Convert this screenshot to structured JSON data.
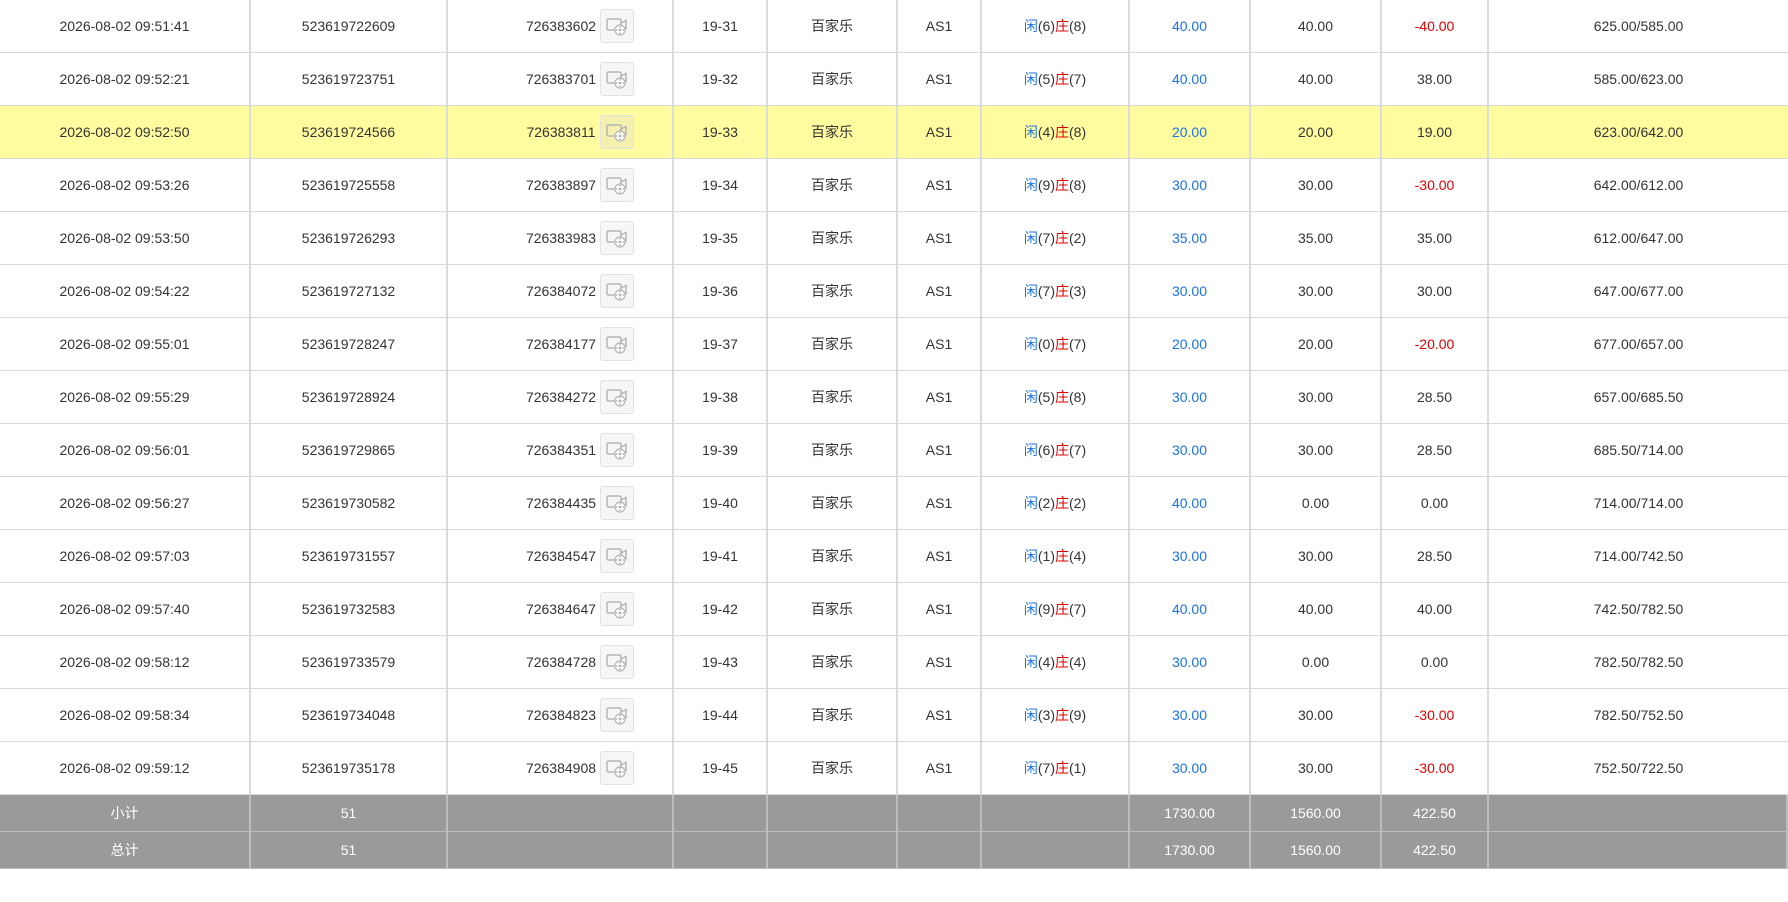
{
  "rows": [
    {
      "time": "2026-08-02 09:51:41",
      "id": "523619722609",
      "round": "726383602",
      "shoe": "19-31",
      "game": "百家乐",
      "table": "AS1",
      "xian_label": "闲",
      "xian": "(6)",
      "zhuang_label": "庄",
      "zhuang": "(8)",
      "bet": "40.00",
      "valid": "40.00",
      "winlose": "-40.00",
      "balance": "625.00/585.00"
    },
    {
      "time": "2026-08-02 09:52:21",
      "id": "523619723751",
      "round": "726383701",
      "shoe": "19-32",
      "game": "百家乐",
      "table": "AS1",
      "xian_label": "闲",
      "xian": "(5)",
      "zhuang_label": "庄",
      "zhuang": "(7)",
      "bet": "40.00",
      "valid": "40.00",
      "winlose": "38.00",
      "balance": "585.00/623.00"
    },
    {
      "time": "2026-08-02 09:52:50",
      "id": "523619724566",
      "round": "726383811",
      "shoe": "19-33",
      "game": "百家乐",
      "table": "AS1",
      "xian_label": "闲",
      "xian": "(4)",
      "zhuang_label": "庄",
      "zhuang": "(8)",
      "bet": "20.00",
      "valid": "20.00",
      "winlose": "19.00",
      "balance": "623.00/642.00"
    },
    {
      "time": "2026-08-02 09:53:26",
      "id": "523619725558",
      "round": "726383897",
      "shoe": "19-34",
      "game": "百家乐",
      "table": "AS1",
      "xian_label": "闲",
      "xian": "(9)",
      "zhuang_label": "庄",
      "zhuang": "(8)",
      "bet": "30.00",
      "valid": "30.00",
      "winlose": "-30.00",
      "balance": "642.00/612.00"
    },
    {
      "time": "2026-08-02 09:53:50",
      "id": "523619726293",
      "round": "726383983",
      "shoe": "19-35",
      "game": "百家乐",
      "table": "AS1",
      "xian_label": "闲",
      "xian": "(7)",
      "zhuang_label": "庄",
      "zhuang": "(2)",
      "bet": "35.00",
      "valid": "35.00",
      "winlose": "35.00",
      "balance": "612.00/647.00"
    },
    {
      "time": "2026-08-02 09:54:22",
      "id": "523619727132",
      "round": "726384072",
      "shoe": "19-36",
      "game": "百家乐",
      "table": "AS1",
      "xian_label": "闲",
      "xian": "(7)",
      "zhuang_label": "庄",
      "zhuang": "(3)",
      "bet": "30.00",
      "valid": "30.00",
      "winlose": "30.00",
      "balance": "647.00/677.00"
    },
    {
      "time": "2026-08-02 09:55:01",
      "id": "523619728247",
      "round": "726384177",
      "shoe": "19-37",
      "game": "百家乐",
      "table": "AS1",
      "xian_label": "闲",
      "xian": "(0)",
      "zhuang_label": "庄",
      "zhuang": "(7)",
      "bet": "20.00",
      "valid": "20.00",
      "winlose": "-20.00",
      "balance": "677.00/657.00"
    },
    {
      "time": "2026-08-02 09:55:29",
      "id": "523619728924",
      "round": "726384272",
      "shoe": "19-38",
      "game": "百家乐",
      "table": "AS1",
      "xian_label": "闲",
      "xian": "(5)",
      "zhuang_label": "庄",
      "zhuang": "(8)",
      "bet": "30.00",
      "valid": "30.00",
      "winlose": "28.50",
      "balance": "657.00/685.50"
    },
    {
      "time": "2026-08-02 09:56:01",
      "id": "523619729865",
      "round": "726384351",
      "shoe": "19-39",
      "game": "百家乐",
      "table": "AS1",
      "xian_label": "闲",
      "xian": "(6)",
      "zhuang_label": "庄",
      "zhuang": "(7)",
      "bet": "30.00",
      "valid": "30.00",
      "winlose": "28.50",
      "balance": "685.50/714.00"
    },
    {
      "time": "2026-08-02 09:56:27",
      "id": "523619730582",
      "round": "726384435",
      "shoe": "19-40",
      "game": "百家乐",
      "table": "AS1",
      "xian_label": "闲",
      "xian": "(2)",
      "zhuang_label": "庄",
      "zhuang": "(2)",
      "bet": "40.00",
      "valid": "0.00",
      "winlose": "0.00",
      "balance": "714.00/714.00"
    },
    {
      "time": "2026-08-02 09:57:03",
      "id": "523619731557",
      "round": "726384547",
      "shoe": "19-41",
      "game": "百家乐",
      "table": "AS1",
      "xian_label": "闲",
      "xian": "(1)",
      "zhuang_label": "庄",
      "zhuang": "(4)",
      "bet": "30.00",
      "valid": "30.00",
      "winlose": "28.50",
      "balance": "714.00/742.50"
    },
    {
      "time": "2026-08-02 09:57:40",
      "id": "523619732583",
      "round": "726384647",
      "shoe": "19-42",
      "game": "百家乐",
      "table": "AS1",
      "xian_label": "闲",
      "xian": "(9)",
      "zhuang_label": "庄",
      "zhuang": "(7)",
      "bet": "40.00",
      "valid": "40.00",
      "winlose": "40.00",
      "balance": "742.50/782.50"
    },
    {
      "time": "2026-08-02 09:58:12",
      "id": "523619733579",
      "round": "726384728",
      "shoe": "19-43",
      "game": "百家乐",
      "table": "AS1",
      "xian_label": "闲",
      "xian": "(4)",
      "zhuang_label": "庄",
      "zhuang": "(4)",
      "bet": "30.00",
      "valid": "0.00",
      "winlose": "0.00",
      "balance": "782.50/782.50"
    },
    {
      "time": "2026-08-02 09:58:34",
      "id": "523619734048",
      "round": "726384823",
      "shoe": "19-44",
      "game": "百家乐",
      "table": "AS1",
      "xian_label": "闲",
      "xian": "(3)",
      "zhuang_label": "庄",
      "zhuang": "(9)",
      "bet": "30.00",
      "valid": "30.00",
      "winlose": "-30.00",
      "balance": "782.50/752.50"
    },
    {
      "time": "2026-08-02 09:59:12",
      "id": "523619735178",
      "round": "726384908",
      "shoe": "19-45",
      "game": "百家乐",
      "table": "AS1",
      "xian_label": "闲",
      "xian": "(7)",
      "zhuang_label": "庄",
      "zhuang": "(1)",
      "bet": "30.00",
      "valid": "30.00",
      "winlose": "-30.00",
      "balance": "752.50/722.50"
    }
  ],
  "highlight_row": 2,
  "icons": {
    "video": "video-replay-icon"
  },
  "colors": {
    "highlight": "#fffca0",
    "footer": "#9a9a9a",
    "positive_blue": "#1a73e8",
    "negative_red": "#e00000"
  },
  "subtotal": {
    "label": "小计",
    "count": "51",
    "bet": "1730.00",
    "valid": "1560.00",
    "winlose": "422.50"
  },
  "total": {
    "label": "总计",
    "count": "51",
    "bet": "1730.00",
    "valid": "1560.00",
    "winlose": "422.50"
  }
}
